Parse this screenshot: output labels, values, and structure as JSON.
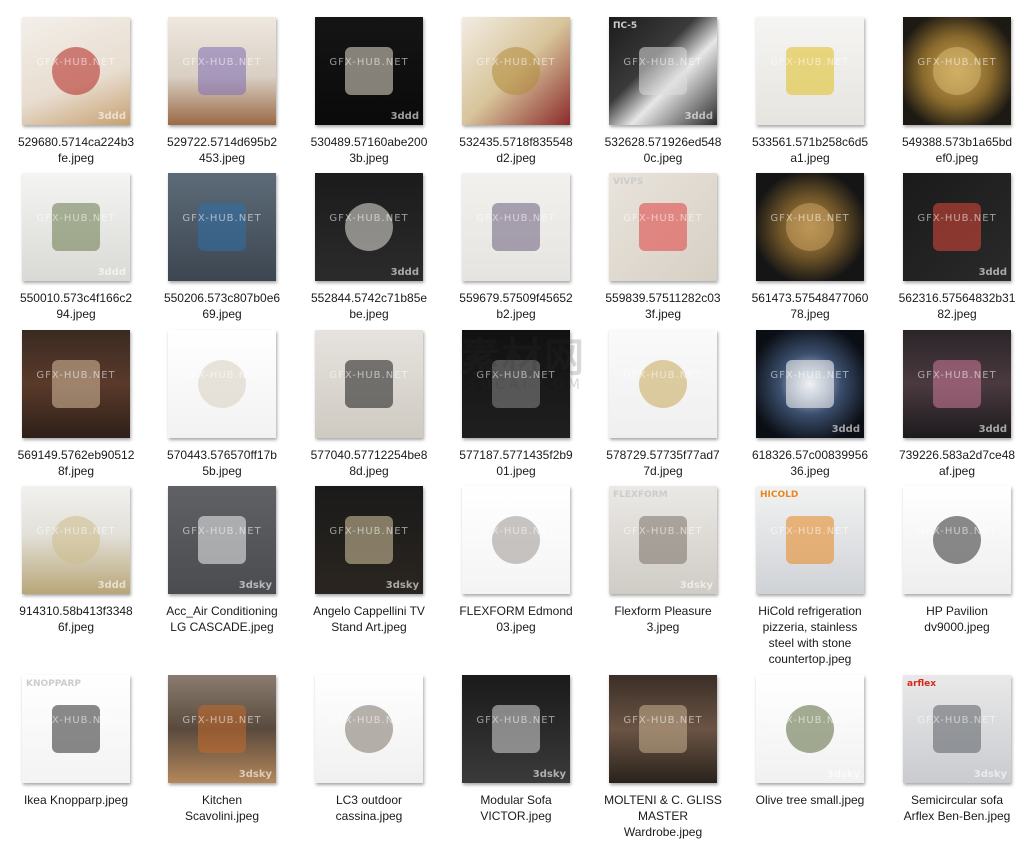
{
  "files": [
    {
      "name_l1": "529680.5714ca224b3",
      "name_l2": "fe.jpeg",
      "name_l3": "",
      "name_l4": "",
      "bg": "linear-gradient(160deg,#f3efe9 0%,#e8ddd0 60%,#c7a070 100%)",
      "accent": "#b3241f",
      "icon": "fruit-basket-thumbnail"
    },
    {
      "name_l1": "529722.5714d695b2",
      "name_l2": "453.jpeg",
      "name_l3": "",
      "name_l4": "",
      "bg": "linear-gradient(180deg,#efe8df 0%,#d9cfc3 55%,#9a6a45 100%)",
      "accent": "#7d6bb5",
      "icon": "lavender-pot-thumbnail"
    },
    {
      "name_l1": "530489.57160abe200",
      "name_l2": "3b.jpeg",
      "name_l3": "",
      "name_l4": "",
      "bg": "linear-gradient(180deg,#151515 0%,#0a0a0a 100%)",
      "accent": "#e8e0cf",
      "icon": "glass-vases-thumbnail"
    },
    {
      "name_l1": "532435.5718f835548",
      "name_l2": "d2.jpeg",
      "name_l3": "",
      "name_l4": "",
      "bg": "linear-gradient(135deg,#f2ece2 0%,#d7c49a 50%,#8b2a2a 100%)",
      "accent": "#b38b3a",
      "icon": "ornate-frames-thumbnail"
    },
    {
      "name_l1": "532628.571926ed548",
      "name_l2": "0c.jpeg",
      "name_l3": "",
      "name_l4": "",
      "bg": "linear-gradient(135deg,#1b1b1b 0%,#3a3a3a 40%,#e7e7e7 60%,#2a2a2a 100%)",
      "accent": "#dddddd",
      "icon": "wave-panel-thumbnail"
    },
    {
      "name_l1": "533561.571b258c6d5",
      "name_l2": "a1.jpeg",
      "name_l3": "",
      "name_l4": "",
      "bg": "linear-gradient(180deg,#f5f5f3 0%,#e6e4df 100%)",
      "accent": "#e0c020",
      "icon": "orchid-decor-thumbnail"
    },
    {
      "name_l1": "549388.573b1a65bd",
      "name_l2": "ef0.jpeg",
      "name_l3": "",
      "name_l4": "",
      "bg": "radial-gradient(circle,#c9a55a 0%,#8a6a2c 45%,#1d1a14 80%)",
      "accent": "#d9b870",
      "icon": "gold-rosette-thumbnail"
    },
    {
      "name_l1": "550010.573c4f166c2",
      "name_l2": "94.jpeg",
      "name_l3": "",
      "name_l4": "",
      "bg": "linear-gradient(180deg,#f4f4f2 0%,#d9d9d6 100%)",
      "accent": "#6a7a4a",
      "icon": "desk-decor-thumbnail"
    },
    {
      "name_l1": "550206.573c807b0e6",
      "name_l2": "69.jpeg",
      "name_l3": "",
      "name_l4": "",
      "bg": "linear-gradient(180deg,#5d6b78 0%,#3c4651 100%)",
      "accent": "#2f6fa8",
      "icon": "blue-vases-thumbnail"
    },
    {
      "name_l1": "552844.5742c71b85e",
      "name_l2": "be.jpeg",
      "name_l3": "",
      "name_l4": "",
      "bg": "linear-gradient(180deg,#1b1b1b 0%,#2b2b2b 100%)",
      "accent": "#e8e4dc",
      "icon": "wedding-dress-thumbnail"
    },
    {
      "name_l1": "559679.57509f45652",
      "name_l2": "b2.jpeg",
      "name_l3": "",
      "name_l4": "",
      "bg": "linear-gradient(180deg,#f2f1ee 0%,#e6e4e0 100%)",
      "accent": "#6b5e7e",
      "icon": "abstract-triptych-thumbnail"
    },
    {
      "name_l1": "559839.57511282c03",
      "name_l2": "3f.jpeg",
      "name_l3": "",
      "name_l4": "",
      "bg": "linear-gradient(135deg,#e9e4dc 0%,#d6cfc4 100%)",
      "accent": "#e04040",
      "icon": "wall-panel-thumbnail"
    },
    {
      "name_l1": "561473.57548477060",
      "name_l2": "78.jpeg",
      "name_l3": "",
      "name_l4": "",
      "bg": "radial-gradient(circle,#b08a4a 0%,#6e5428 40%,#151515 75%)",
      "accent": "#c8a060",
      "icon": "round-mirror-thumbnail"
    },
    {
      "name_l1": "562316.57564832b31",
      "name_l2": "82.jpeg",
      "name_l3": "",
      "name_l4": "",
      "bg": "linear-gradient(135deg,#1a1a1a 0%,#2a2a2a 100%)",
      "accent": "#e04a3a",
      "icon": "color-canvases-thumbnail"
    },
    {
      "name_l1": "569149.5762eb90512",
      "name_l2": "8f.jpeg",
      "name_l3": "",
      "name_l4": "",
      "bg": "linear-gradient(180deg,#3a2a22 0%,#5a3a2a 50%,#2e1f18 100%)",
      "accent": "#d8c0a0",
      "icon": "wood-blocks-thumbnail"
    },
    {
      "name_l1": "570443.576570ff17b",
      "name_l2": "5b.jpeg",
      "name_l3": "",
      "name_l4": "",
      "bg": "linear-gradient(180deg,#ffffff 0%,#f2f2f2 100%)",
      "accent": "#d8cfc0",
      "icon": "gown-mannequins-thumbnail"
    },
    {
      "name_l1": "577040.57712254be8",
      "name_l2": "8d.jpeg",
      "name_l3": "",
      "name_l4": "",
      "bg": "linear-gradient(180deg,#e6e3de 0%,#cfcac2 100%)",
      "accent": "#1a1a1a",
      "icon": "decor-set-thumbnail"
    },
    {
      "name_l1": "577187.5771435f2b9",
      "name_l2": "01.jpeg",
      "name_l3": "",
      "name_l4": "",
      "bg": "linear-gradient(180deg,#111111 0%,#1f1f1f 100%)",
      "accent": "#8a8a8a",
      "icon": "damask-panel-thumbnail"
    },
    {
      "name_l1": "578729.57735f77ad7",
      "name_l2": "7d.jpeg",
      "name_l3": "",
      "name_l4": "",
      "bg": "linear-gradient(180deg,#fafafa 0%,#efefef 100%)",
      "accent": "#c8a85a",
      "icon": "butterfly-art-thumbnail"
    },
    {
      "name_l1": "618326.57c00839956",
      "name_l2": "36.jpeg",
      "name_l3": "",
      "name_l4": "",
      "bg": "radial-gradient(circle,#d9dfe8 0%,#3b4f6e 40%,#0b0e14 80%)",
      "accent": "#ffffff",
      "icon": "framed-burst-thumbnail"
    },
    {
      "name_l1": "739226.583a2d7ce48",
      "name_l2": "af.jpeg",
      "name_l3": "",
      "name_l4": "",
      "bg": "linear-gradient(180deg,#2a2528 0%,#4a3a40 50%,#1c1a1c 100%)",
      "accent": "#d07a9a",
      "icon": "table-setting-thumbnail"
    },
    {
      "name_l1": "914310.58b413f3348",
      "name_l2": "6f.jpeg",
      "name_l3": "",
      "name_l4": "",
      "bg": "linear-gradient(180deg,#f1f1ef 0%,#e2e0d8 45%,#b9a678 100%)",
      "accent": "#cdbb8b",
      "icon": "parquet-floor-thumbnail"
    },
    {
      "name_l1": "Acc_Air Conditioning",
      "name_l2": "LG CASCADE.jpeg",
      "name_l3": "",
      "name_l4": "",
      "bg": "linear-gradient(180deg,#5f6165 0%,#4a4c50 100%)",
      "accent": "#f2f2f2",
      "icon": "air-conditioner-thumbnail"
    },
    {
      "name_l1": "Angelo Cappellini TV",
      "name_l2": "Stand Art.jpeg",
      "name_l3": "",
      "name_l4": "",
      "bg": "linear-gradient(180deg,#1a1a1a 0%,#2a2520 100%)",
      "accent": "#d8c8a0",
      "icon": "tv-stand-thumbnail"
    },
    {
      "name_l1": "FLEXFORM Edmond",
      "name_l2": "03.jpeg",
      "name_l3": "",
      "name_l4": "",
      "bg": "linear-gradient(180deg,#ffffff 0%,#f4f4f4 100%)",
      "accent": "#9a9690",
      "icon": "sofa-thumbnail"
    },
    {
      "name_l1": "Flexform Pleasure",
      "name_l2": "3.jpeg",
      "name_l3": "",
      "name_l4": "",
      "bg": "linear-gradient(180deg,#ebe9e6 0%,#cfcbc5 100%)",
      "accent": "#7a7168",
      "icon": "sectional-sofa-thumbnail"
    },
    {
      "name_l1": "HiCold refrigeration",
      "name_l2": "pizzeria, stainless",
      "name_l3": "steel with stone",
      "name_l4": "countertop.jpeg",
      "bg": "linear-gradient(180deg,#f2f2f2 0%,#cfd2d6 100%)",
      "accent": "#e8871e",
      "icon": "refrigerator-thumbnail"
    },
    {
      "name_l1": "HP Pavilion",
      "name_l2": "dv9000.jpeg",
      "name_l3": "",
      "name_l4": "",
      "bg": "linear-gradient(180deg,#ffffff 0%,#eeeeee 100%)",
      "accent": "#2b2b2b",
      "icon": "laptop-thumbnail"
    },
    {
      "name_l1": "Ikea Knopparp.jpeg",
      "name_l2": "",
      "name_l3": "",
      "name_l4": "",
      "bg": "linear-gradient(180deg,#ffffff 0%,#f3f3f3 100%)",
      "accent": "#2a2a2a",
      "icon": "black-sofa-thumbnail"
    },
    {
      "name_l1": "Kitchen",
      "name_l2": "Scavolini.jpeg",
      "name_l3": "",
      "name_l4": "",
      "bg": "linear-gradient(180deg,#8a7c70 0%,#5a4a3e 50%,#b3875a 100%)",
      "accent": "#c46a2a",
      "icon": "kitchen-thumbnail"
    },
    {
      "name_l1": "LC3 outdoor",
      "name_l2": "cassina.jpeg",
      "name_l3": "",
      "name_l4": "",
      "bg": "linear-gradient(180deg,#ffffff 0%,#f0f0f0 100%)",
      "accent": "#7d736a",
      "icon": "armchair-thumbnail"
    },
    {
      "name_l1": "Modular Sofa",
      "name_l2": "VICTOR.jpeg",
      "name_l3": "",
      "name_l4": "",
      "bg": "linear-gradient(180deg,#1a1a1a 0%,#3a3a3a 100%)",
      "accent": "#d8d8d8",
      "icon": "modular-sofa-thumbnail"
    },
    {
      "name_l1": "MOLTENI & C. GLISS",
      "name_l2": "MASTER",
      "name_l3": "Wardrobe.jpeg",
      "name_l4": "",
      "bg": "linear-gradient(180deg,#3a2e26 0%,#6a5444 50%,#2a221c 100%)",
      "accent": "#c8b090",
      "icon": "wardrobe-thumbnail"
    },
    {
      "name_l1": "Olive tree small.jpeg",
      "name_l2": "",
      "name_l3": "",
      "name_l4": "",
      "bg": "linear-gradient(180deg,#ffffff 0%,#f1f1f1 100%)",
      "accent": "#5a6a3a",
      "icon": "olive-tree-thumbnail"
    },
    {
      "name_l1": "Semicircular sofa",
      "name_l2": "Arflex Ben-Ben.jpeg",
      "name_l3": "",
      "name_l4": "",
      "bg": "linear-gradient(180deg,#e9e9e9 0%,#c9cbcf 100%)",
      "accent": "#5a5d63",
      "icon": "curved-sofa-thumbnail"
    }
  ],
  "thumb_marks": {
    "wm_text": "GFX-HUB.NET",
    "brand_3ddd": "3ddd",
    "brand_3dsky": "3dsky",
    "panel_code": "ПС-5",
    "vivps": "VIVPS",
    "hicold": "HICOLD",
    "flexform": "FLEXFORM",
    "arflex": "arflex",
    "knopparp": "KNOPPARP"
  },
  "site_watermark": {
    "big": "素材网",
    "small": "SUCAI.COM"
  }
}
